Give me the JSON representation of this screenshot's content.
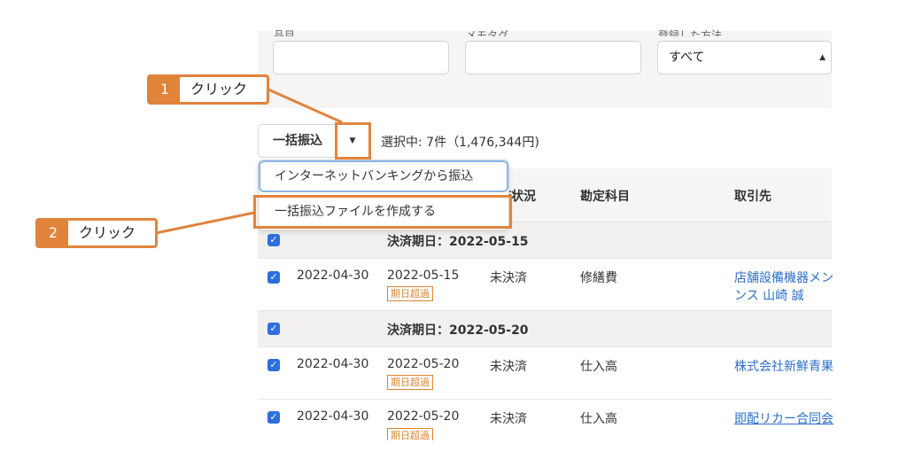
{
  "filters": {
    "labels": [
      "品目",
      "メモタグ",
      "登録した方法"
    ],
    "method_select_value": "すべて"
  },
  "toolbar": {
    "bulk_button_label": "一括振込",
    "selection_info": "選択中: 7件（1,476,344円)"
  },
  "dropdown": {
    "items": [
      "インターネットバンキングから振込",
      "一括振込ファイルを作成する"
    ]
  },
  "table": {
    "headers": [
      "済状況",
      "勘定科目",
      "取引先"
    ],
    "groups": [
      {
        "label": "決済期日：2022-05-15",
        "rows": [
          {
            "date": "2022-04-30",
            "due": "2022-05-15",
            "badge": "期日超過",
            "status": "未決済",
            "account": "修繕費",
            "partner_line1": "店舗設備機器メン",
            "partner_line2": "ンス 山崎 誠"
          }
        ]
      },
      {
        "label": "決済期日：2022-05-20",
        "rows": [
          {
            "date": "2022-04-30",
            "due": "2022-05-20",
            "badge": "期日超過",
            "status": "未決済",
            "account": "仕入高",
            "partner_line1": "株式会社新鮮青果"
          },
          {
            "date": "2022-04-30",
            "due": "2022-05-20",
            "badge": "期日超過",
            "status": "未決済",
            "account": "仕入高",
            "partner_line1": "即配リカー合同会"
          }
        ]
      }
    ]
  },
  "annotations": {
    "callout1": {
      "number": "1",
      "text": "クリック"
    },
    "callout2": {
      "number": "2",
      "text": "クリック"
    },
    "color": "#e0843c"
  },
  "colors": {
    "checkbox": "#2d6fdc",
    "link": "#2b6fc9",
    "badge": "#d98534"
  }
}
